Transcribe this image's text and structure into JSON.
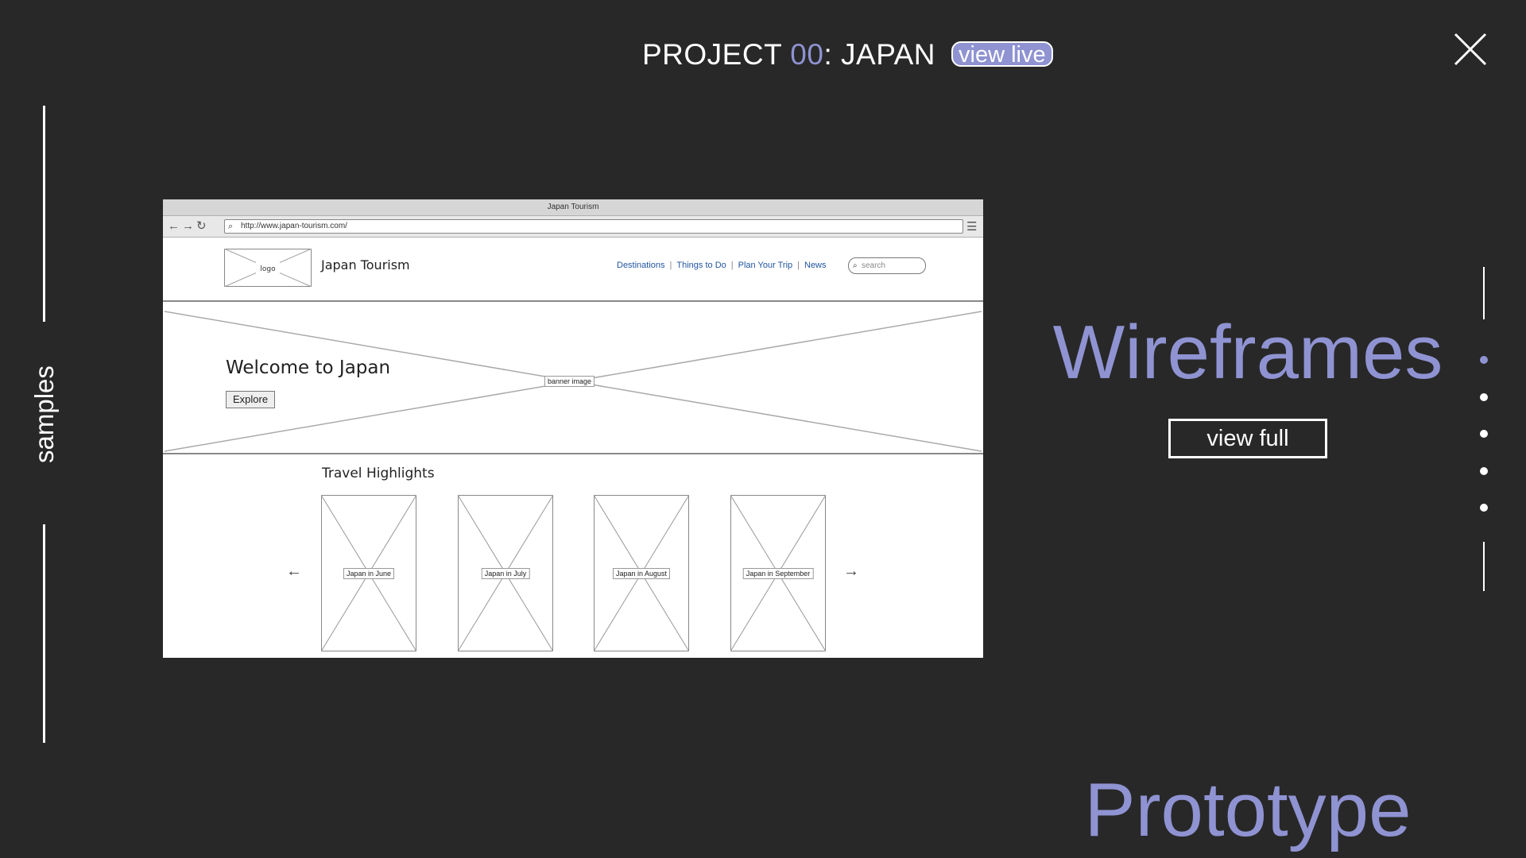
{
  "header": {
    "project_prefix": "PROJECT ",
    "project_number": "00",
    "project_suffix": ": JAPAN",
    "view_live_label": "view live"
  },
  "sidebar": {
    "label": "samples"
  },
  "section": {
    "title": "Wireframes",
    "view_full_label": "view full",
    "next_title": "Prototype",
    "dots": 5,
    "active_dot": 0
  },
  "wireframe": {
    "window_title": "Japan Tourism",
    "url": "http://www.japan-tourism.com/",
    "logo_label": "logo",
    "site_name": "Japan Tourism",
    "nav": [
      "Destinations",
      "Things to Do",
      "Plan Your Trip",
      "News"
    ],
    "search_placeholder": "search",
    "banner_title": "Welcome to Japan",
    "banner_button": "Explore",
    "banner_label": "banner image",
    "highlights_title": "Travel Highlights",
    "cards": [
      "Japan in June",
      "Japan in July",
      "Japan in August",
      "Japan in September"
    ],
    "prev_arrow": "←",
    "next_arrow": "→"
  },
  "colors": {
    "background": "#282828",
    "accent": "#8f93d2",
    "foreground": "#ffffff"
  },
  "icons": {
    "close": "close-icon",
    "search": "search-icon",
    "menu": "hamburger-icon"
  }
}
